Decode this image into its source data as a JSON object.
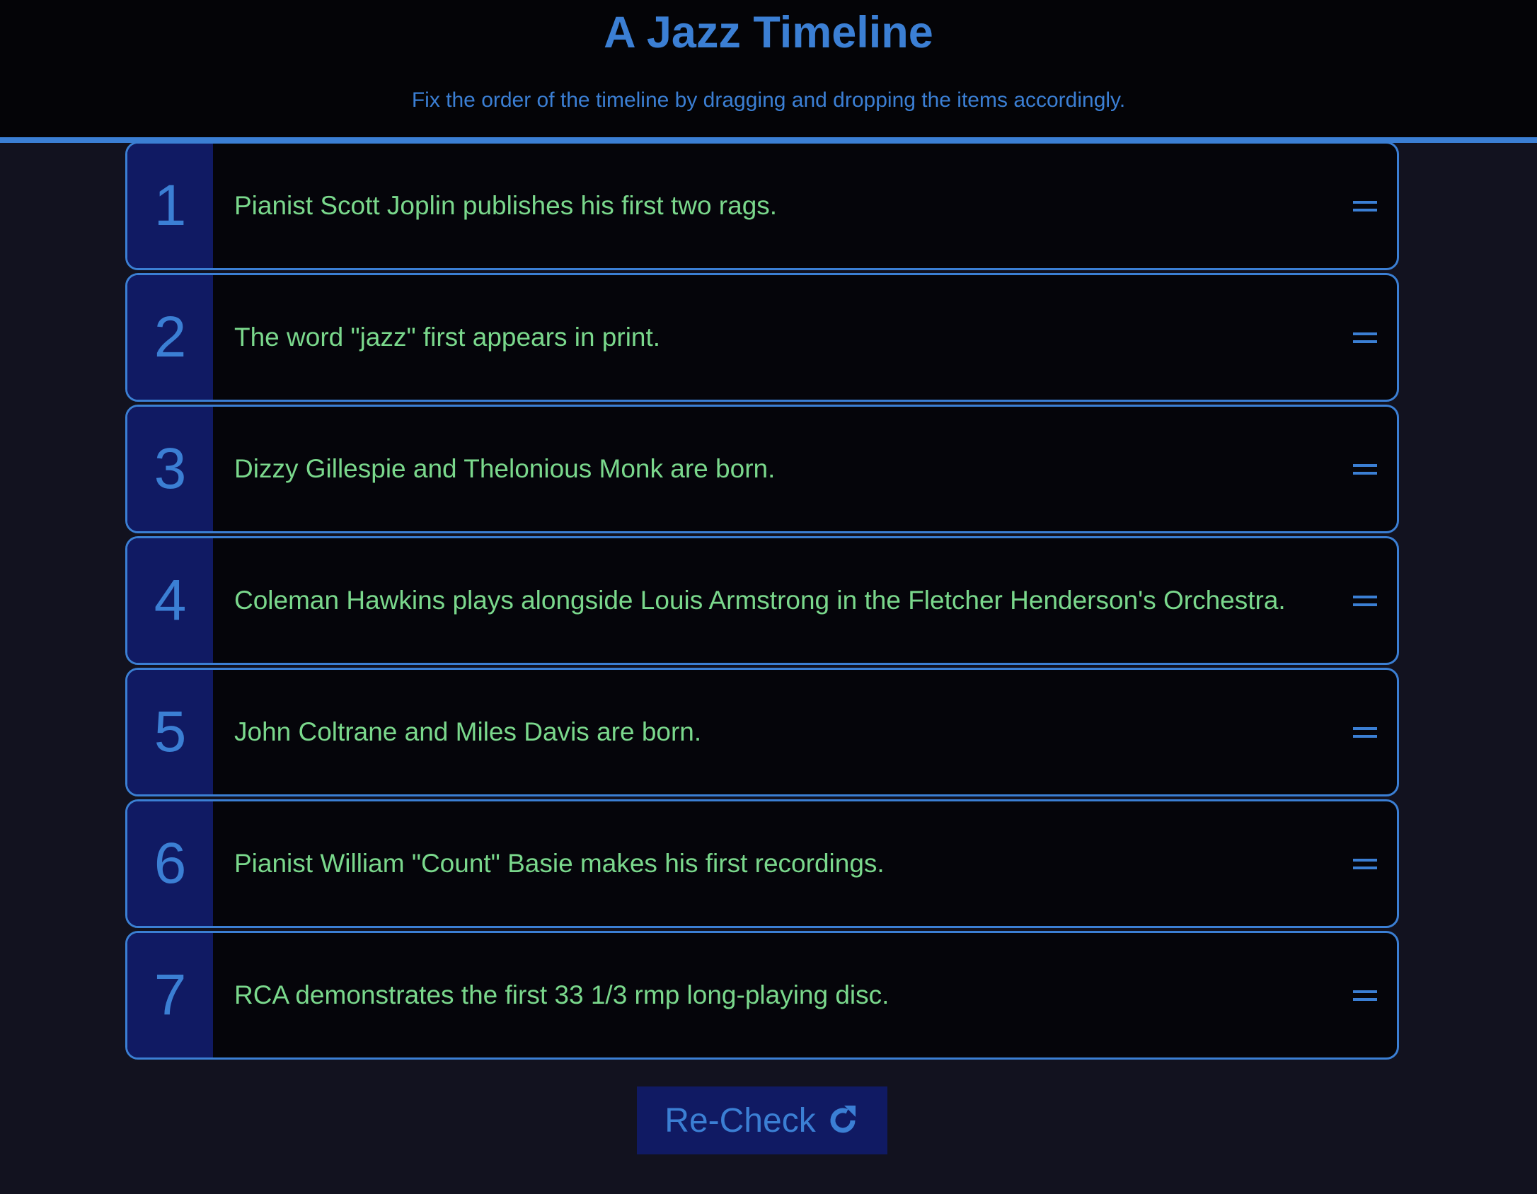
{
  "header": {
    "title": "A Jazz Timeline",
    "subtitle": "Fix the order of the timeline by dragging and dropping the items accordingly."
  },
  "timeline": {
    "items": [
      {
        "number": "1",
        "text": "Pianist Scott Joplin publishes his first two rags."
      },
      {
        "number": "2",
        "text": "The word \"jazz\" first appears in print."
      },
      {
        "number": "3",
        "text": "Dizzy Gillespie and Thelonious Monk are born."
      },
      {
        "number": "4",
        "text": "Coleman Hawkins plays alongside Louis Armstrong in the Fletcher Henderson's Orchestra."
      },
      {
        "number": "5",
        "text": "John Coltrane and Miles Davis are born."
      },
      {
        "number": "6",
        "text": "Pianist William \"Count\" Basie makes his first recordings."
      },
      {
        "number": "7",
        "text": "RCA demonstrates the first 33 1/3 rmp long-playing disc."
      }
    ],
    "handle_icon": "drag-handle-icon"
  },
  "recheck_button": {
    "label": "Re-Check",
    "icon": "refresh-icon"
  },
  "colors": {
    "accent": "#3b7fd4",
    "item_text": "#7ad88c",
    "number_bg": "#101a63",
    "page_bg": "#12121f",
    "header_bg": "#040407"
  }
}
